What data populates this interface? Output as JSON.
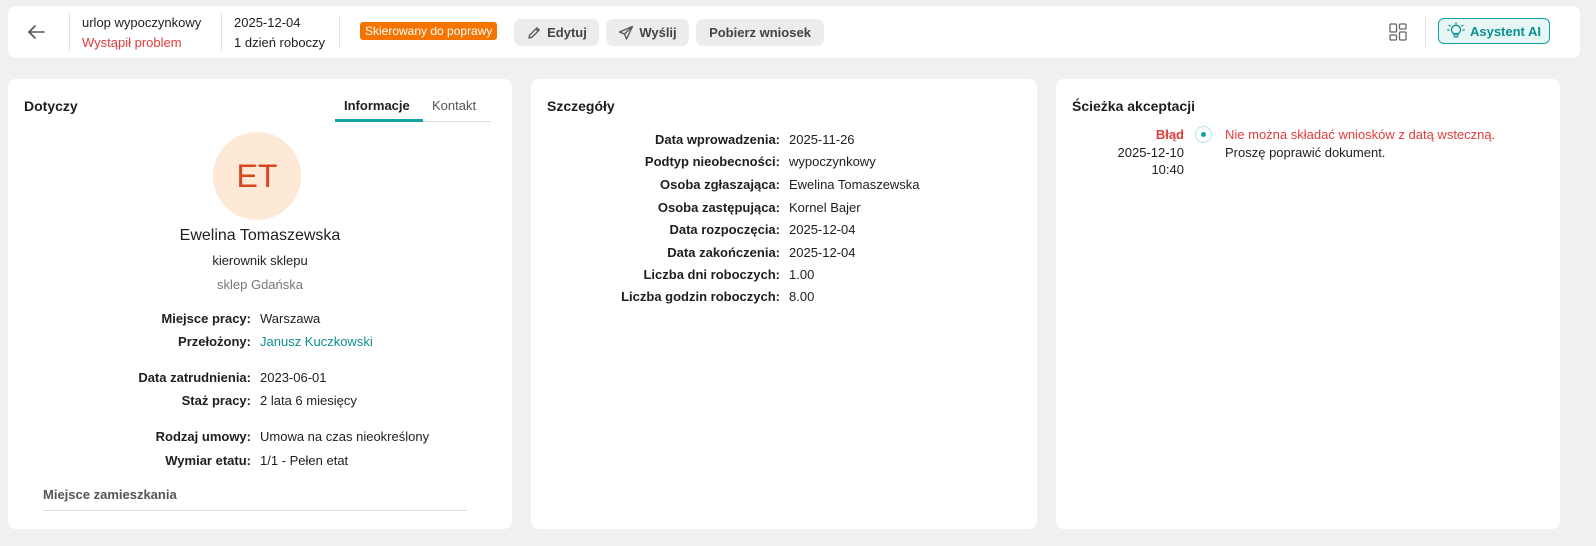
{
  "header": {
    "request_type": "urlop wypoczynkowy",
    "problem": "Wystąpił problem",
    "date": "2025-12-04",
    "duration": "1 dzień roboczy",
    "status_badge": "Skierowany do poprawy",
    "edit_label": "Edytuj",
    "send_label": "Wyślij",
    "download_label": "Pobierz wniosek",
    "ai_label": "Asystent AI",
    "accent_color": "#14a3a3",
    "badge_color": "#f57400"
  },
  "concerns": {
    "title": "Dotyczy",
    "tabs": [
      "Informacje",
      "Kontakt"
    ],
    "active_tab": "Informacje",
    "avatar_initials": "ET",
    "name": "Ewelina Tomaszewska",
    "role": "kierownik sklepu",
    "shop": "sklep Gdańska",
    "fields": [
      {
        "label": "Miejsce pracy:",
        "value": "Warszawa"
      },
      {
        "label": "Przełożony:",
        "value": "Janusz Kuczkowski"
      },
      {
        "label": "Data zatrudnienia:",
        "value": "2023-06-01"
      },
      {
        "label": "Staż pracy:",
        "value": "2 lata 6 miesięcy"
      },
      {
        "label": "Rodzaj umowy:",
        "value": "Umowa na czas nieokreślony"
      },
      {
        "label": "Wymiar etatu:",
        "value": "1/1 - Pełen etat"
      }
    ],
    "residence_section": "Miejsce zamieszkania"
  },
  "details": {
    "title": "Szczegóły",
    "fields": [
      {
        "label": "Data wprowadzenia:",
        "value": "2025-11-26"
      },
      {
        "label": "Podtyp nieobecności:",
        "value": "wypoczynkowy"
      },
      {
        "label": "Osoba zgłaszająca:",
        "value": "Ewelina Tomaszewska"
      },
      {
        "label": "Osoba zastępująca:",
        "value": "Kornel Bajer"
      },
      {
        "label": "Data rozpoczęcia:",
        "value": "2025-12-04"
      },
      {
        "label": "Data zakończenia:",
        "value": "2025-12-04"
      },
      {
        "label": "Liczba dni roboczych:",
        "value": "1.00"
      },
      {
        "label": "Liczba godzin roboczych:",
        "value": "8.00"
      }
    ]
  },
  "acceptance": {
    "title": "Ścieżka akceptacji",
    "steps": [
      {
        "status": "Błąd",
        "date": "2025-12-10",
        "time": "10:40",
        "message_error": "Nie można składać wniosków z datą wsteczną.",
        "message": "Proszę poprawić dokument."
      }
    ]
  }
}
